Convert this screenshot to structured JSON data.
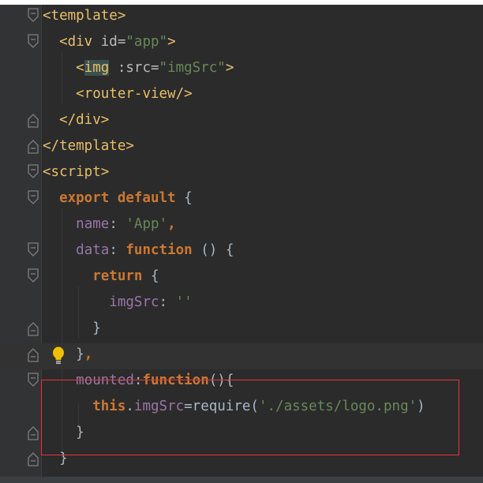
{
  "code_lines": [
    {
      "fold": "open",
      "tokens": [
        {
          "t": "<template>",
          "c": "tag"
        }
      ]
    },
    {
      "fold": "open",
      "tokens": [
        {
          "t": "  "
        },
        {
          "t": "<div ",
          "c": "tag"
        },
        {
          "t": "id=",
          "c": "attr"
        },
        {
          "t": "\"app\"",
          "c": "str"
        },
        {
          "t": ">",
          "c": "tag"
        }
      ]
    },
    {
      "fold": "none",
      "tokens": [
        {
          "t": "    "
        },
        {
          "t": "<",
          "c": "tag"
        },
        {
          "t": "img",
          "c": "hl-img"
        },
        {
          "t": " :src=",
          "c": "attr"
        },
        {
          "t": "\"imgSrc\"",
          "c": "str"
        },
        {
          "t": ">",
          "c": "tag"
        }
      ]
    },
    {
      "fold": "none",
      "tokens": [
        {
          "t": "    "
        },
        {
          "t": "<router-view/>",
          "c": "tag"
        }
      ]
    },
    {
      "fold": "close",
      "tokens": [
        {
          "t": "  "
        },
        {
          "t": "</div>",
          "c": "tag"
        }
      ]
    },
    {
      "fold": "close",
      "tokens": [
        {
          "t": "</template>",
          "c": "tag"
        }
      ]
    },
    {
      "fold": "open",
      "tokens": [
        {
          "t": "<script>",
          "c": "tag"
        }
      ]
    },
    {
      "fold": "open",
      "tokens": [
        {
          "t": "  "
        },
        {
          "t": "export default",
          "c": "kw"
        },
        {
          "t": " {",
          "c": "plain"
        }
      ]
    },
    {
      "fold": "none",
      "tokens": [
        {
          "t": "    "
        },
        {
          "t": "name",
          "c": "prop"
        },
        {
          "t": ": ",
          "c": "plain"
        },
        {
          "t": "'App'",
          "c": "str"
        },
        {
          "t": ",",
          "c": "kw"
        }
      ]
    },
    {
      "fold": "open",
      "tokens": [
        {
          "t": "    "
        },
        {
          "t": "data",
          "c": "prop"
        },
        {
          "t": ": ",
          "c": "plain"
        },
        {
          "t": "function",
          "c": "kw"
        },
        {
          "t": " () {",
          "c": "plain"
        }
      ]
    },
    {
      "fold": "open",
      "tokens": [
        {
          "t": "      "
        },
        {
          "t": "return",
          "c": "kw"
        },
        {
          "t": " {",
          "c": "plain"
        }
      ]
    },
    {
      "fold": "none",
      "tokens": [
        {
          "t": "        "
        },
        {
          "t": "imgSrc",
          "c": "prop"
        },
        {
          "t": ": ",
          "c": "plain"
        },
        {
          "t": "''",
          "c": "str"
        }
      ]
    },
    {
      "fold": "close",
      "tokens": [
        {
          "t": "      "
        },
        {
          "t": "}",
          "c": "plain"
        }
      ]
    },
    {
      "fold": "close",
      "tokens": [
        {
          "t": "    "
        },
        {
          "t": "}",
          "c": "plain"
        },
        {
          "t": ",",
          "c": "kw"
        }
      ],
      "current": true,
      "bulb": true
    },
    {
      "fold": "open",
      "tokens": [
        {
          "t": "    "
        },
        {
          "t": "mounted",
          "c": "prop"
        },
        {
          "t": ":",
          "c": "plain"
        },
        {
          "t": "function",
          "c": "kw"
        },
        {
          "t": "(){",
          "c": "plain"
        }
      ]
    },
    {
      "fold": "none",
      "tokens": [
        {
          "t": "      "
        },
        {
          "t": "this",
          "c": "kw"
        },
        {
          "t": ".",
          "c": "plain"
        },
        {
          "t": "imgSrc",
          "c": "prop"
        },
        {
          "t": "=require(",
          "c": "plain"
        },
        {
          "t": "'./assets/logo.png'",
          "c": "str"
        },
        {
          "t": ")",
          "c": "plain"
        }
      ]
    },
    {
      "fold": "close",
      "tokens": [
        {
          "t": "    "
        },
        {
          "t": "}",
          "c": "plain"
        }
      ]
    },
    {
      "fold": "close",
      "tokens": [
        {
          "t": "  "
        },
        {
          "t": "}",
          "c": "plain"
        }
      ]
    }
  ],
  "colors": {
    "background": "#2b2b2b",
    "tag": "#e8bf6a",
    "string": "#6a8759",
    "keyword": "#cc7832",
    "property": "#9876aa",
    "plain": "#a9b7c6",
    "highlight_box": "#e5353a"
  },
  "icons": {
    "fold_marker": "fold-marker-icon",
    "intention_bulb": "lightbulb-icon"
  }
}
